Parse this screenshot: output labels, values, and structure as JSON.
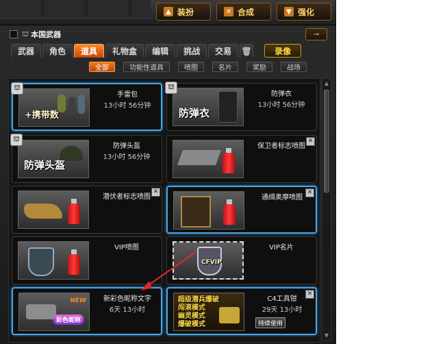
{
  "top_buttons": [
    {
      "label": "装扮",
      "icon": "dress-icon"
    },
    {
      "label": "合成",
      "icon": "hammer-icon"
    },
    {
      "label": "强化",
      "icon": "upgrade-icon"
    }
  ],
  "header": {
    "title": "本国武器",
    "key_button": "⊸"
  },
  "tabs": [
    {
      "label": "武器"
    },
    {
      "label": "角色"
    },
    {
      "label": "道具"
    },
    {
      "label": "礼物盒"
    },
    {
      "label": "编辑"
    },
    {
      "label": "挑战"
    },
    {
      "label": "交易"
    },
    {
      "label": "🗑"
    },
    {
      "label": "录像"
    }
  ],
  "subtabs": [
    "全部",
    "功能性道具",
    "喷图",
    "名片",
    "奖励",
    "战场"
  ],
  "items": [
    {
      "name": "手雷包",
      "time": "13小时 56分钟",
      "thumb_text": "+携带数"
    },
    {
      "name": "防弹衣",
      "time": "13小时 56分钟",
      "thumb_text": "防弹衣"
    },
    {
      "name": "防弹头盔",
      "time": "13小时 56分钟",
      "thumb_text": "防弹头盔"
    },
    {
      "name": "保卫者标志喷图",
      "time": "",
      "thumb_text": ""
    },
    {
      "name": "潜伏者标志喷图",
      "time": "",
      "thumb_text": ""
    },
    {
      "name": "通缉奥摩喷图",
      "time": "",
      "thumb_text": ""
    },
    {
      "name": "VIP喷图",
      "time": "",
      "thumb_text": ""
    },
    {
      "name": "VIP名片",
      "time": "",
      "thumb_text": "CFVIP"
    },
    {
      "name": "新彩色昵称文字",
      "time": "6天 13小时",
      "thumb_text": "彩色昵称",
      "badge": "NEW"
    },
    {
      "name": "C4工具钳",
      "time": "29天 13小时",
      "thumb_text": "超级潜兵爆破\n闯滚模式\n幽灵模式\n爆破模式",
      "button": "持续使用"
    }
  ],
  "colors": {
    "selected_border": "#4aa6e6",
    "active_tab": "#f37a1f",
    "annotation_arrow": "#e02a2a"
  }
}
